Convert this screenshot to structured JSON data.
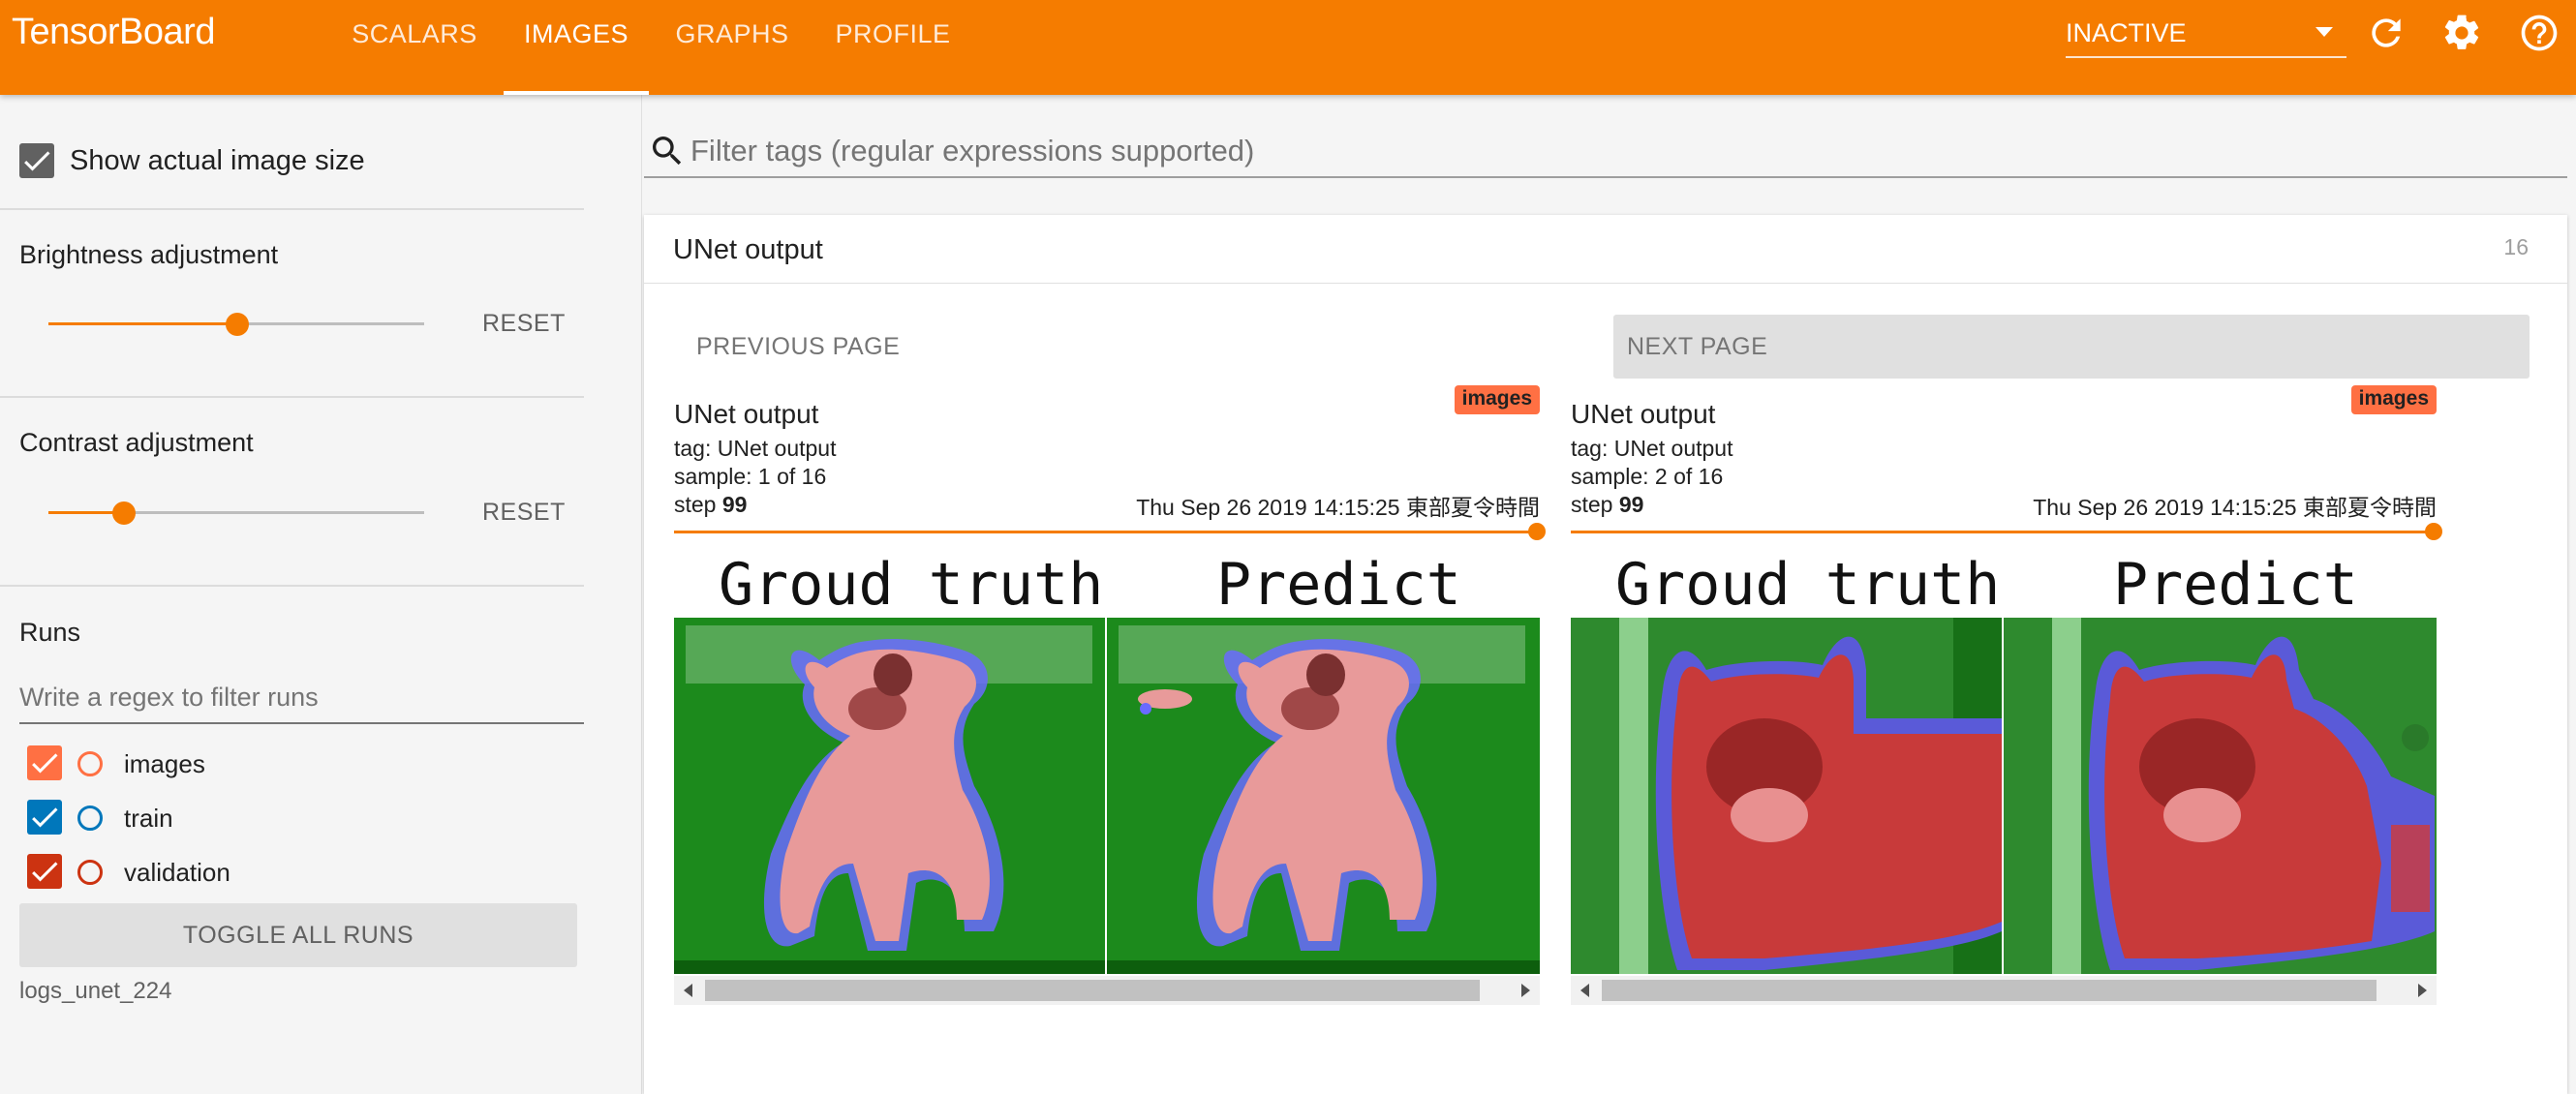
{
  "app": {
    "brand": "TensorBoard",
    "tabs": [
      "SCALARS",
      "IMAGES",
      "GRAPHS",
      "PROFILE"
    ],
    "active_tab": "IMAGES",
    "run_status": "INACTIVE",
    "icons": [
      "refresh-icon",
      "settings-icon",
      "help-icon"
    ]
  },
  "sidebar": {
    "show_actual_size": {
      "label": "Show actual image size",
      "checked": true
    },
    "brightness": {
      "label": "Brightness adjustment",
      "value_fraction": 0.5,
      "reset": "RESET"
    },
    "contrast": {
      "label": "Contrast adjustment",
      "value_fraction": 0.2,
      "reset": "RESET"
    },
    "runs": {
      "title": "Runs",
      "filter_placeholder": "Write a regex to filter runs",
      "items": [
        {
          "name": "images",
          "checked": true,
          "color": "#ff7043"
        },
        {
          "name": "train",
          "checked": true,
          "color": "#0077bb"
        },
        {
          "name": "validation",
          "checked": true,
          "color": "#cc3311"
        }
      ],
      "toggle_all": "TOGGLE ALL RUNS",
      "logdir": "logs_unet_224"
    }
  },
  "main": {
    "filter_placeholder": "Filter tags (regular expressions supported)",
    "card": {
      "title": "UNet output",
      "count": "16",
      "prev_page": "PREVIOUS PAGE",
      "next_page": "NEXT PAGE",
      "panes": [
        {
          "title": "UNet output",
          "tag": "tag: UNet output",
          "sample": "sample: 1 of 16",
          "step_label": "step",
          "step_value": "99",
          "run_badge": "images",
          "time": "Thu Sep 26 2019 14:15:25 東部夏令時間",
          "image": {
            "left_caption": "Groud truth",
            "right_caption": "Predict",
            "subject": "dog"
          }
        },
        {
          "title": "UNet output",
          "tag": "tag: UNet output",
          "sample": "sample: 2 of 16",
          "step_label": "step",
          "step_value": "99",
          "run_badge": "images",
          "time": "Thu Sep 26 2019 14:15:25 東部夏令時間",
          "image": {
            "left_caption": "Groud truth",
            "right_caption": "Predict",
            "subject": "cat"
          }
        }
      ]
    }
  },
  "colors": {
    "accent": "#f57c00",
    "badge": "#ff7043"
  }
}
